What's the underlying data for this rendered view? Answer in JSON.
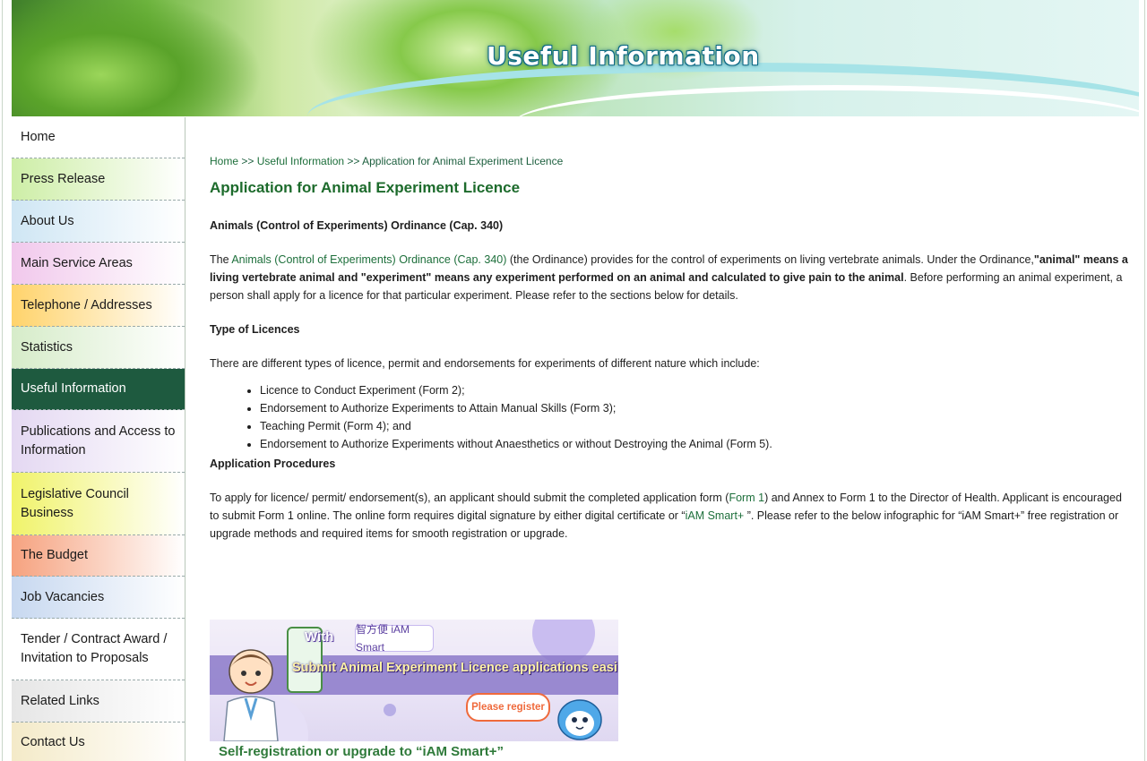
{
  "banner": {
    "title": "Useful Information"
  },
  "sidebar": {
    "items": [
      {
        "label": "Home",
        "color": "#ffffff"
      },
      {
        "label": "Press Release",
        "color": "#cdeea6"
      },
      {
        "label": "About Us",
        "color": "#cfe6f4"
      },
      {
        "label": "Main Service Areas",
        "color": "#f1c8ec"
      },
      {
        "label": "Telephone / Addresses",
        "color": "#ffd36b"
      },
      {
        "label": "Statistics",
        "color": "#d6ecc9"
      },
      {
        "label": "Useful Information",
        "color": "#1e5a3f",
        "active": true
      },
      {
        "label": "Publications and Access to Information",
        "color": "#e4d8f2"
      },
      {
        "label": "Legislative Council Business",
        "color": "#f0f36a"
      },
      {
        "label": "The Budget",
        "color": "#f6a27f"
      },
      {
        "label": "Job Vacancies",
        "color": "#c7d8f0"
      },
      {
        "label": "Tender / Contract Award / Invitation to Proposals",
        "color": "#ffffff"
      },
      {
        "label": "Related Links",
        "color": "#e6e6e6"
      },
      {
        "label": "Contact Us",
        "color": "#f4eac8"
      }
    ]
  },
  "breadcrumb": {
    "home": "Home",
    "sep1": " >> ",
    "section": "Useful Information",
    "sep2": " >> ",
    "current": "Application for Animal Experiment Licence"
  },
  "main": {
    "title": "Application for Animal Experiment Licence",
    "ordinance_heading": "Animals (Control of Experiments) Ordinance (Cap. 340)",
    "intro": {
      "pre": "The ",
      "link": "Animals (Control of Experiments) Ordinance (Cap. 340)",
      "mid": " (the Ordinance) provides for the control of experiments on living vertebrate animals. Under the Ordinance,",
      "bold": "\"animal\" means a living vertebrate animal and \"experiment\" means any experiment performed on an animal and calculated to give pain to the animal",
      "post": ". Before performing an animal experiment, a person shall apply for a licence for that particular experiment. Please refer to the sections below for details."
    },
    "types_heading": "Type of Licences",
    "types_intro": "There are different types of licence, permit and endorsements for experiments of different nature which include:",
    "types_list": [
      "Licence to Conduct Experiment (Form 2);",
      "Endorsement to Authorize Experiments to Attain Manual Skills (Form 3);",
      "Teaching Permit (Form 4); and",
      "Endorsement to Authorize Experiments without Anaesthetics or without Destroying the Animal (Form 5)."
    ],
    "procedures_heading": "Application Procedures",
    "procedures": {
      "p1": "To apply for licence/ permit/ endorsement(s), an applicant should submit the completed application form (",
      "form_link": "Form 1",
      "p2": ") and Annex to Form 1 to the Director of Health. Applicant is encouraged to submit Form 1 online. The online form requires digital signature by either digital certificate or “",
      "iam_link": "iAM Smart+ ",
      "p3": "”. Please refer to the below infographic for “iAM Smart+” free registration or upgrade methods and required items for smooth registration or upgrade."
    }
  },
  "promo": {
    "with": "With",
    "logo": "智方便 iAM Smart",
    "submit": "Submit Animal Experiment Licence applications easily!",
    "please": "Please register",
    "footer": "Self-registration or upgrade to “iAM Smart+”"
  }
}
